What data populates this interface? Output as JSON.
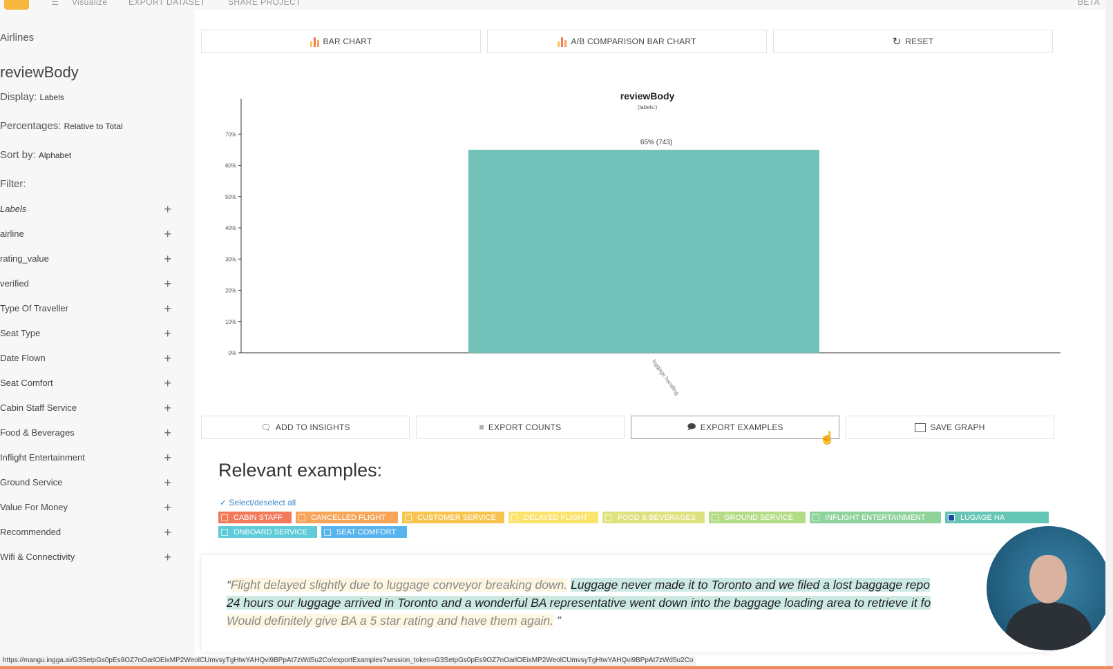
{
  "topbar": {
    "visualize": "Visualize",
    "export_dataset": "EXPORT DATASET",
    "share_project": "SHARE PROJECT",
    "beta": "BETA"
  },
  "sidebar": {
    "dataset": "Airlines",
    "variable": "reviewBody",
    "display_label": "Display:",
    "display_value": "Labels",
    "percent_label": "Percentages:",
    "percent_value": "Relative to Total",
    "sort_label": "Sort by:",
    "sort_value": "Alphabet",
    "filter_label": "Filter:",
    "filters": [
      "Labels",
      "airline",
      "rating_value",
      "verified",
      "Type Of Traveller",
      "Seat Type",
      "Date Flown",
      "Seat Comfort",
      "Cabin Staff Service",
      "Food & Beverages",
      "Inflight Entertainment",
      "Ground Service",
      "Value For Money",
      "Recommended",
      "Wifi & Connectivity"
    ],
    "plus": "+"
  },
  "toolbar": {
    "bar_chart": "BAR CHART",
    "ab_chart": "A/B COMPARISON BAR CHART",
    "reset": "RESET"
  },
  "chart_data": {
    "type": "bar",
    "title": "reviewBody",
    "subtitle": "(labels:)",
    "categories": [
      "luggage handling"
    ],
    "values": [
      65
    ],
    "data_labels": [
      "65% (743)"
    ],
    "ylim": [
      0,
      80
    ],
    "yticks": [
      "0%",
      "10%",
      "20%",
      "30%",
      "40%",
      "50%",
      "60%",
      "70%"
    ],
    "bar_color": "#72c2b9",
    "grid": false
  },
  "actions": {
    "add_insights": "ADD TO INSIGHTS",
    "export_counts": "EXPORT COUNTS",
    "export_examples": "EXPORT EXAMPLES",
    "save_graph": "SAVE GRAPH"
  },
  "examples": {
    "title": "Relevant examples:",
    "select_all": "Select/deselect all",
    "tags": [
      {
        "label": "CABIN STAFF",
        "color": "#f2795a",
        "checked": false
      },
      {
        "label": "CANCELLED FLIGHT",
        "color": "#f8a55a",
        "checked": false
      },
      {
        "label": "CUSTOMER SERVICE",
        "color": "#f8c450",
        "checked": false
      },
      {
        "label": "DELAYED FLIGHT",
        "color": "#fbe36c",
        "checked": false
      },
      {
        "label": "FOOD & BEVERAGES",
        "color": "#dfe17d",
        "checked": false
      },
      {
        "label": "GROUND SERVICE",
        "color": "#b4dc86",
        "checked": false
      },
      {
        "label": "INFLIGHT ENTERTAINMENT",
        "color": "#8ed39a",
        "checked": false
      },
      {
        "label": "LUGAGE HA",
        "color": "#66c6b6",
        "checked": true
      },
      {
        "label": "ONBOARD SERVICE",
        "color": "#5fcbd9",
        "checked": false
      },
      {
        "label": "SEAT COMFORT",
        "color": "#58b4ec",
        "checked": false
      }
    ],
    "quote_open": "“",
    "quote_part1": "Flight delayed slightly due to luggage conveyor breaking down.",
    "quote_part2": "Luggage never made it to Toronto and we filed a lost baggage repo",
    "quote_part3": "24 hours our luggage arrived in Toronto and a wonderful BA representative went down into the baggage loading area to retrieve it fo",
    "quote_part4": "Would definitely give BA a 5 star rating and have them again.",
    "quote_close": " ”"
  },
  "status_url": "https://mangu.ingga.ai/G3SetpGs0pEs9OZ7nOarlOEixMP2WeolCUmvsyTgHtwYAHQvi9BPpAt7zWd5u2Co/exportExamples?session_token=G3SetpGs0pEs9OZ7nOarlOEixMP2WeolCUmvsyTgHtwYAHQvi9BPpAt7zWd5u2Co"
}
